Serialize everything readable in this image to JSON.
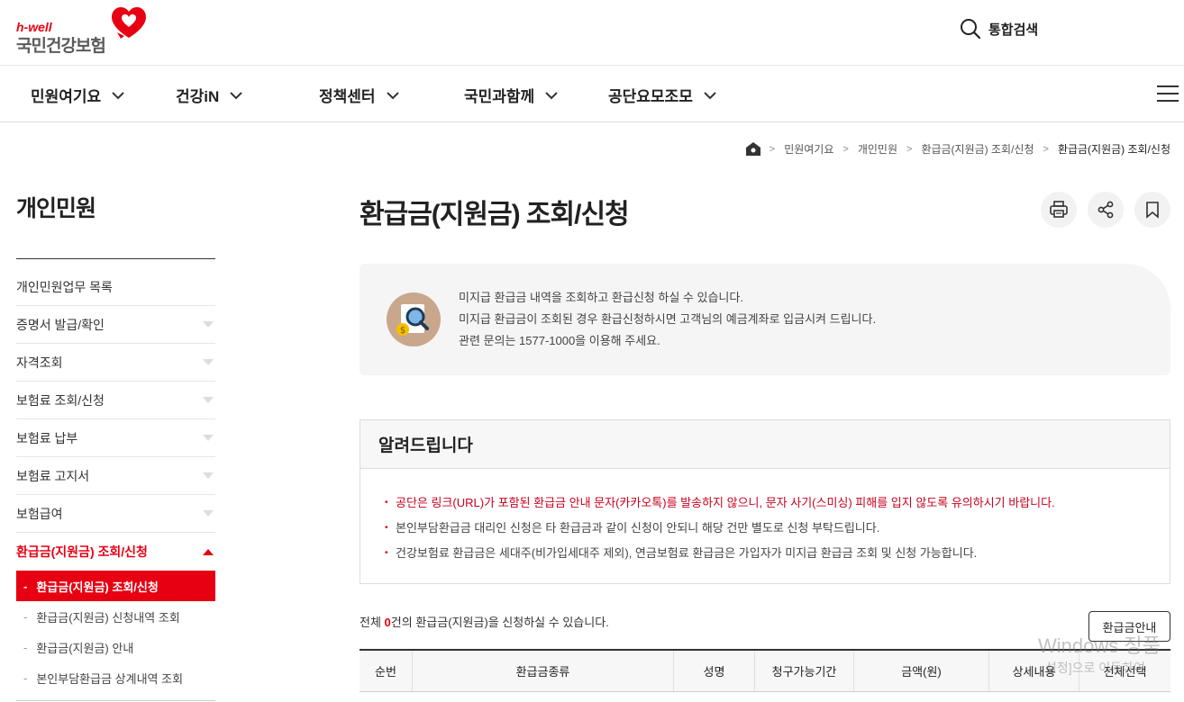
{
  "header": {
    "logo_sub": "h-well",
    "logo_name": "국민건강보험",
    "search_label": "통합검색"
  },
  "gnb": {
    "items": [
      "민원여기요",
      "건강iN",
      "정책센터",
      "국민과함께",
      "공단요모조모"
    ]
  },
  "breadcrumb": {
    "items": [
      "민원여기요",
      "개인민원",
      "환급금(지원금) 조회/신청",
      "환급금(지원금) 조회/신청"
    ]
  },
  "sidebar": {
    "title": "개인민원",
    "items": [
      {
        "label": "개인민원업무 목록"
      },
      {
        "label": "증명서 발급/확인"
      },
      {
        "label": "자격조회"
      },
      {
        "label": "보험료 조회/신청"
      },
      {
        "label": "보험료 납부"
      },
      {
        "label": "보험료 고지서"
      },
      {
        "label": "보험급여"
      },
      {
        "label": "환급금(지원금) 조회/신청"
      }
    ],
    "sub_items": [
      "환급금(지원금) 조회/신청",
      "환급금(지원금) 신청내역 조회",
      "환급금(지원금) 안내",
      "본인부담환급금 상계내역 조회"
    ]
  },
  "main": {
    "title": "환급금(지원금) 조회/신청",
    "intro_lines": [
      "미지급 환급금 내역을 조회하고 환급신청 하실 수 있습니다.",
      "미지급 환급금이 조회된 경우 환급신청하시면 고객님의 예금계좌로 입금시켜 드립니다.",
      "관련 문의는 1577-1000을 이용해 주세요."
    ],
    "notice": {
      "title": "알려드립니다",
      "items": [
        "공단은 링크(URL)가 포함된 환급금 안내 문자(카카오톡)를 발송하지 않으니, 문자 사기(스미싱) 피해를 입지 않도록 유의하시기 바랍니다.",
        "본인부담환급금 대리인 신청은 타 환급금과 같이 신청이 안되니 해당 건만 별도로 신청 부탁드립니다.",
        "건강보험료 환급금은 세대주(비가입세대주 제외), 연금보험료 환급금은 가입자가 미지급 환급금 조회 및 신청 가능합니다."
      ]
    },
    "count_prefix": "전체 ",
    "count_value": "0",
    "count_suffix": "건의 환급금(지원금)을 신청하실 수 있습니다.",
    "guide_button": "환급금안내",
    "table_headers": [
      "순번",
      "환급금종류",
      "성명",
      "청구가능기간",
      "금액(원)",
      "상세내용",
      "전체선택"
    ]
  },
  "overlay": {
    "watermark_line1": "Windows 정품",
    "watermark_line2": "설정]으로 이동하여"
  },
  "colors": {
    "brand_red": "#e60012",
    "text_dark": "#222222",
    "intro_bg": "#f5f5f5"
  }
}
